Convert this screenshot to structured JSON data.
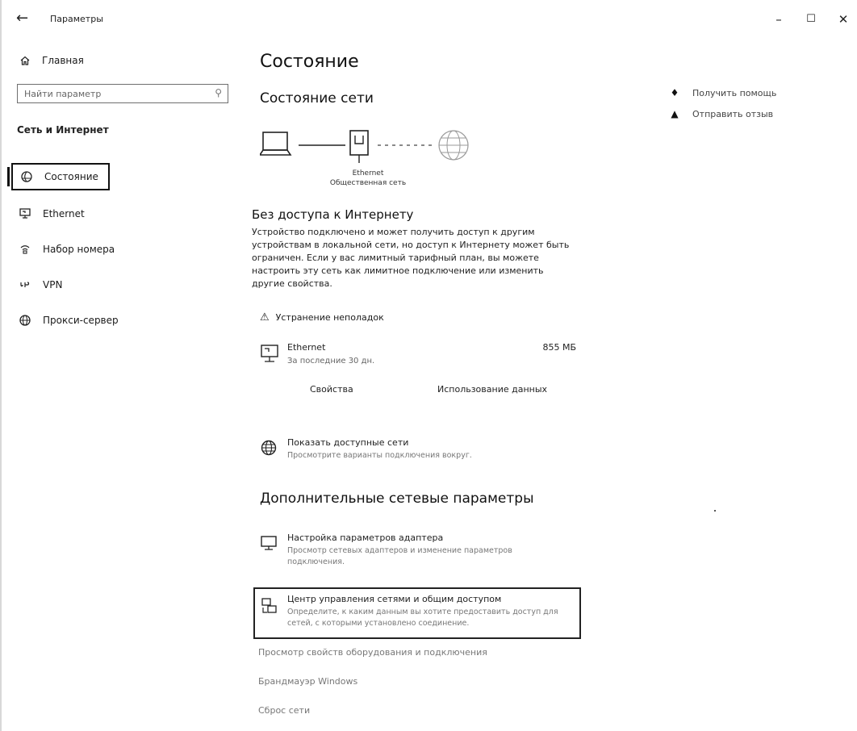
{
  "window": {
    "title": "Параметры",
    "back_icon": "arrow-left-icon",
    "controls": {
      "minimize": "–",
      "maximize": "☐",
      "close": "✕"
    }
  },
  "sidebar": {
    "home_label": "Главная",
    "search_placeholder": "Найти параметр",
    "section_title": "Сеть и Интернет",
    "items": [
      {
        "label": "Состояние",
        "icon": "status-globe-icon",
        "selected": true
      },
      {
        "label": "Ethernet",
        "icon": "ethernet-icon",
        "selected": false
      },
      {
        "label": "Набор номера",
        "icon": "dialup-icon",
        "selected": false
      },
      {
        "label": "VPN",
        "icon": "vpn-icon",
        "selected": false
      },
      {
        "label": "Прокси-сервер",
        "icon": "globe-icon",
        "selected": false
      }
    ]
  },
  "main": {
    "page_title": "Состояние",
    "network_status_heading": "Состояние сети",
    "diagram": {
      "adapter_label": "Ethernet",
      "network_label": "Общественная сеть"
    },
    "no_internet_heading": "Без доступа к Интернету",
    "no_internet_text": "Устройство подключено и может получить доступ к другим устройствам в локальной сети, но доступ к Интернету может быть ограничен. Если у вас лимитный тарифный план, вы можете настроить эту сеть как лимитное подключение или изменить другие свойства.",
    "troubleshoot_label": "Устранение неполадок",
    "ethernet": {
      "name": "Ethernet",
      "subtitle": "За последние 30 дн.",
      "usage": "855 МБ"
    },
    "properties_label": "Свойства",
    "data_usage_label": "Использование данных",
    "show_networks": {
      "title": "Показать доступные сети",
      "subtitle": "Просмотрите варианты подключения вокруг."
    },
    "advanced_heading": "Дополнительные сетевые параметры",
    "adapter_settings": {
      "title": "Настройка параметров адаптера",
      "subtitle": "Просмотр сетевых адаптеров и изменение параметров подключения."
    },
    "sharing_center": {
      "title": "Центр управления сетями и общим доступом",
      "subtitle": "Определите, к каким данным вы хотите предоставить доступ для сетей, с которыми установлено соединение."
    },
    "links": {
      "hardware_props": "Просмотр свойств оборудования и подключения",
      "firewall": "Брандмауэр Windows",
      "reset": "Сброс сети"
    }
  },
  "right": {
    "help_label": "Получить помощь",
    "feedback_label": "Отправить отзыв"
  }
}
